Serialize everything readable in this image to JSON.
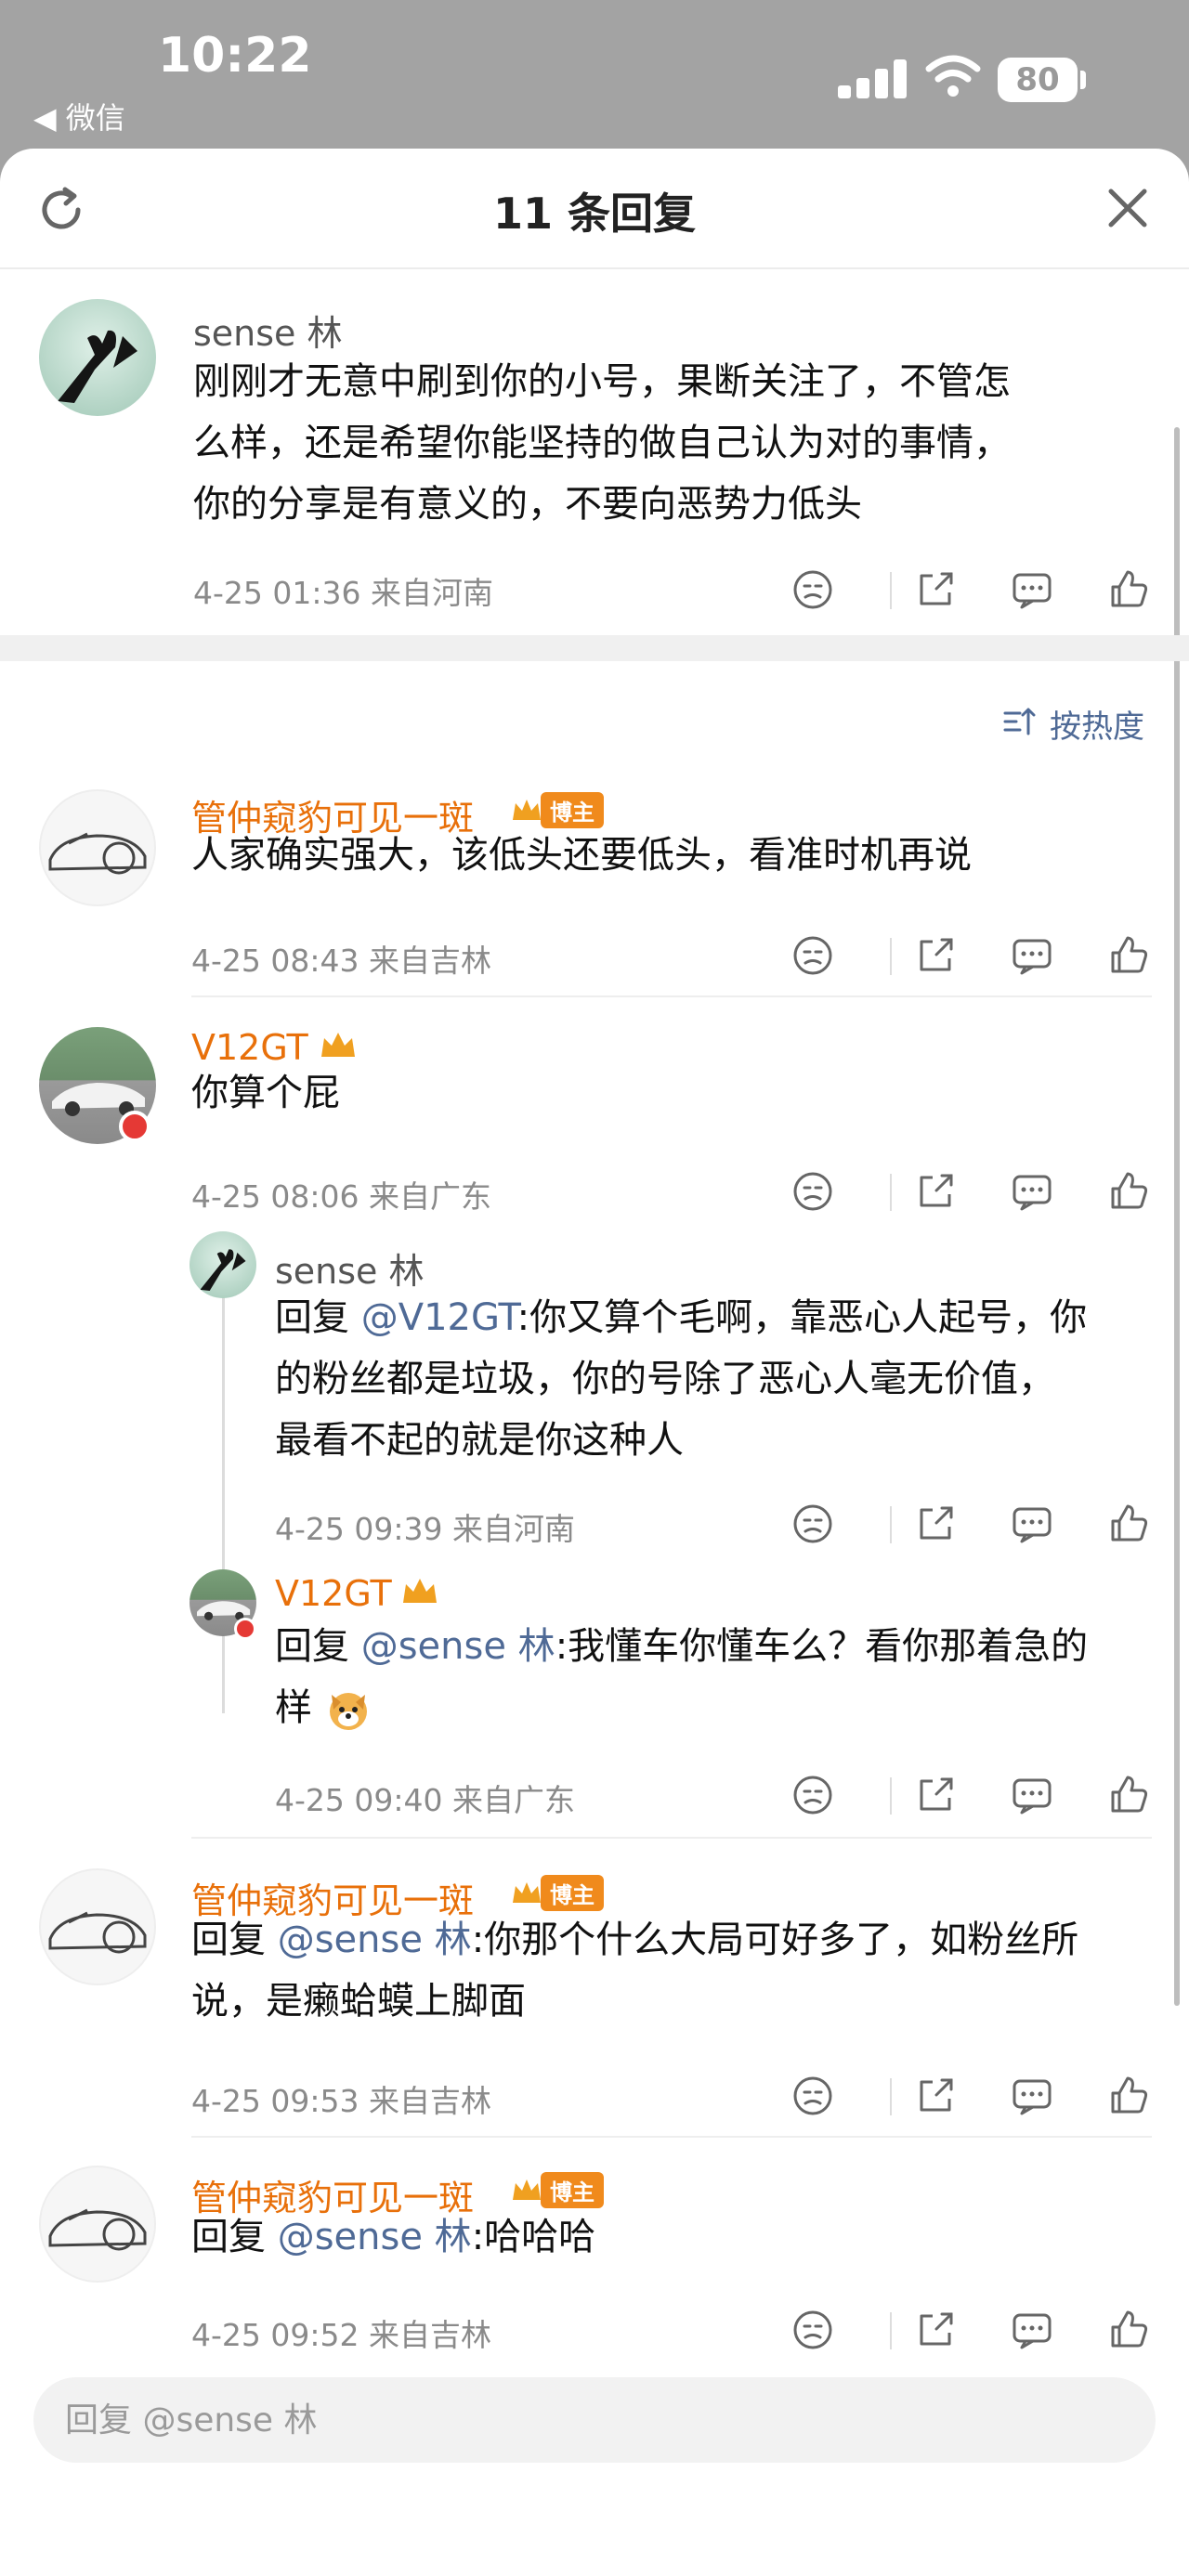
{
  "status_bar": {
    "time": "10:22",
    "back_label": "◀ 微信",
    "battery": "80"
  },
  "header": {
    "title": "11 条回复",
    "refresh_icon": "refresh-icon",
    "close_icon": "close-icon"
  },
  "root_comment": {
    "user": "sense 林",
    "lines": [
      "刚刚才无意中刷到你的小号，果断关注了，不管怎",
      "么样，还是希望你能坚持的做自己认为对的事情，",
      "你的分享是有意义的，不要向恶势力低头"
    ],
    "meta": "4-25 01:36  来自河南"
  },
  "sort_label": "按热度",
  "host_tag": "博主",
  "replies": [
    {
      "user": "管仲窥豹可见一斑",
      "lines": [
        "人家确实强大，该低头还要低头，看准时机再说"
      ],
      "meta": "4-25 08:43  来自吉林"
    },
    {
      "user": "V12GT",
      "lines": [
        "你算个屁"
      ],
      "meta": "4-25 08:06  来自广东"
    },
    {
      "user": "管仲窥豹可见一斑",
      "prefix": "回复 ",
      "mention": "@sense 林",
      "lines": [
        ":你那个什么大局可好多了，如粉丝所",
        "说，是癞蛤蟆上脚面"
      ],
      "meta": "4-25 09:53  来自吉林"
    },
    {
      "user": "管仲窥豹可见一斑",
      "prefix": "回复 ",
      "mention": "@sense 林",
      "lines": [
        ":哈哈哈"
      ],
      "meta": "4-25 09:52  来自吉林"
    }
  ],
  "sub_replies": [
    {
      "user": "sense 林",
      "prefix": "回复 ",
      "mention": "@V12GT",
      "lines": [
        ":你又算个毛啊，靠恶心人起号，你",
        "的粉丝都是垃圾，你的号除了恶心人毫无价值，",
        "最看不起的就是你这种人"
      ],
      "meta": "4-25 09:39  来自河南"
    },
    {
      "user": "V12GT",
      "prefix": "回复 ",
      "mention": "@sense 林",
      "lines": [
        ":我懂车你懂车么？看你那着急的",
        "样"
      ],
      "meta": "4-25 09:40  来自广东"
    }
  ],
  "reply_input": {
    "placeholder": "回复 @sense 林"
  },
  "colors": {
    "accent_orange": "#e8700a",
    "mention_blue": "#4f6a96",
    "meta_gray": "#8a8a8a"
  }
}
